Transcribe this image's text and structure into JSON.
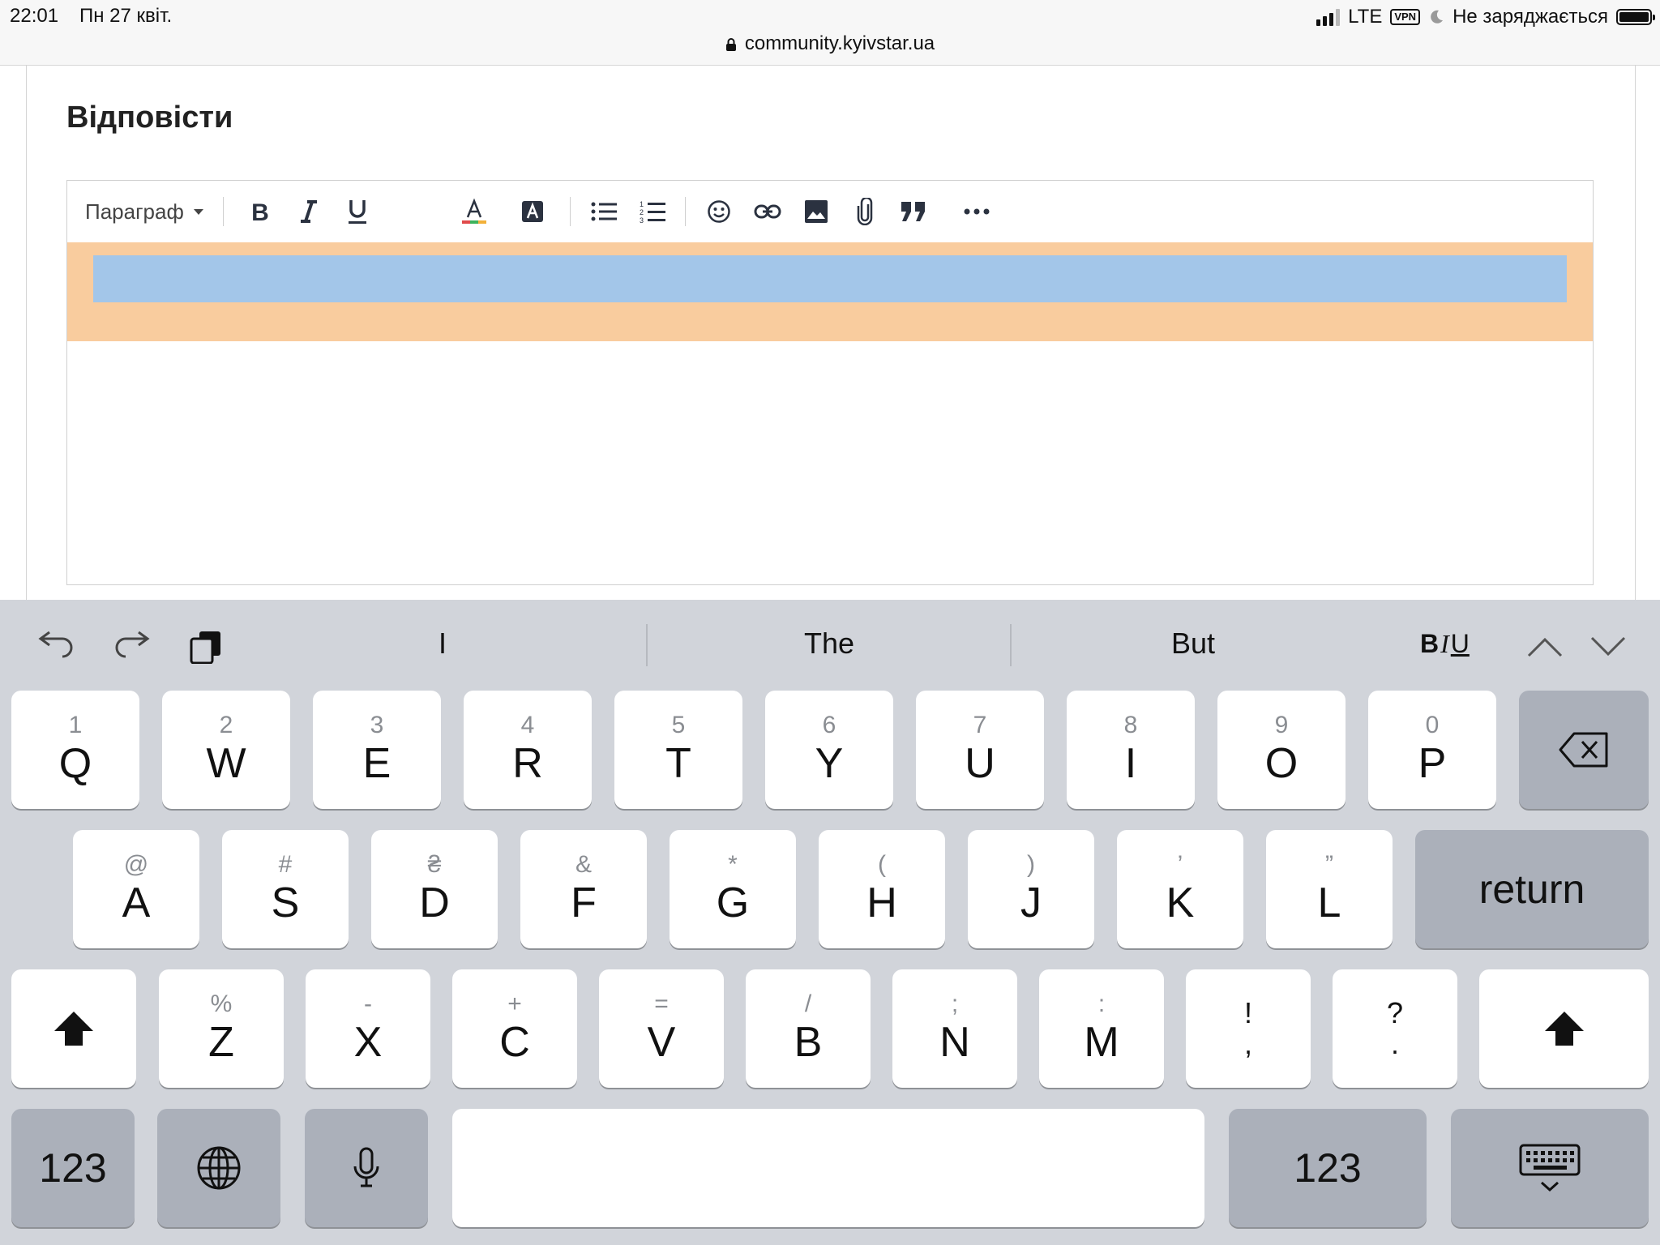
{
  "status_bar": {
    "time": "22:01",
    "date": "Пн 27 квіт.",
    "network": "LTE",
    "vpn": "VPN",
    "charging": "Не заряджається",
    "url": "community.kyivstar.ua"
  },
  "page": {
    "title": "Відповісти"
  },
  "editor": {
    "paragraph_select": "Параграф",
    "toolbar_icons": [
      "bold-icon",
      "italic-icon",
      "underline-icon",
      "text-color-icon",
      "highlight-icon",
      "bullet-list-icon",
      "numbered-list-icon",
      "emoji-icon",
      "link-icon",
      "image-icon",
      "attachment-icon",
      "quote-icon",
      "more-icon"
    ],
    "colors": {
      "quote_bg": "#f9cc9e",
      "selection": "#a3c6e9"
    }
  },
  "keyboard": {
    "suggestions": [
      "I",
      "The",
      "But"
    ],
    "format_label": {
      "b": "B",
      "i": "I",
      "u": "U"
    },
    "row1": [
      {
        "sec": "1",
        "pri": "Q"
      },
      {
        "sec": "2",
        "pri": "W"
      },
      {
        "sec": "3",
        "pri": "E"
      },
      {
        "sec": "4",
        "pri": "R"
      },
      {
        "sec": "5",
        "pri": "T"
      },
      {
        "sec": "6",
        "pri": "Y"
      },
      {
        "sec": "7",
        "pri": "U"
      },
      {
        "sec": "8",
        "pri": "I"
      },
      {
        "sec": "9",
        "pri": "O"
      },
      {
        "sec": "0",
        "pri": "P"
      }
    ],
    "row2": [
      {
        "sec": "@",
        "pri": "A"
      },
      {
        "sec": "#",
        "pri": "S"
      },
      {
        "sec": "₴",
        "pri": "D"
      },
      {
        "sec": "&",
        "pri": "F"
      },
      {
        "sec": "*",
        "pri": "G"
      },
      {
        "sec": "(",
        "pri": "H"
      },
      {
        "sec": ")",
        "pri": "J"
      },
      {
        "sec": "’",
        "pri": "K"
      },
      {
        "sec": "”",
        "pri": "L"
      }
    ],
    "row3": [
      {
        "sec": "%",
        "pri": "Z"
      },
      {
        "sec": "-",
        "pri": "X"
      },
      {
        "sec": "+",
        "pri": "C"
      },
      {
        "sec": "=",
        "pri": "V"
      },
      {
        "sec": "/",
        "pri": "B"
      },
      {
        "sec": ";",
        "pri": "N"
      },
      {
        "sec": ":",
        "pri": "M"
      }
    ],
    "punct": [
      {
        "top": "!",
        "bottom": ","
      },
      {
        "top": "?",
        "bottom": "."
      }
    ],
    "return_label": "return",
    "numbers_label": "123"
  }
}
